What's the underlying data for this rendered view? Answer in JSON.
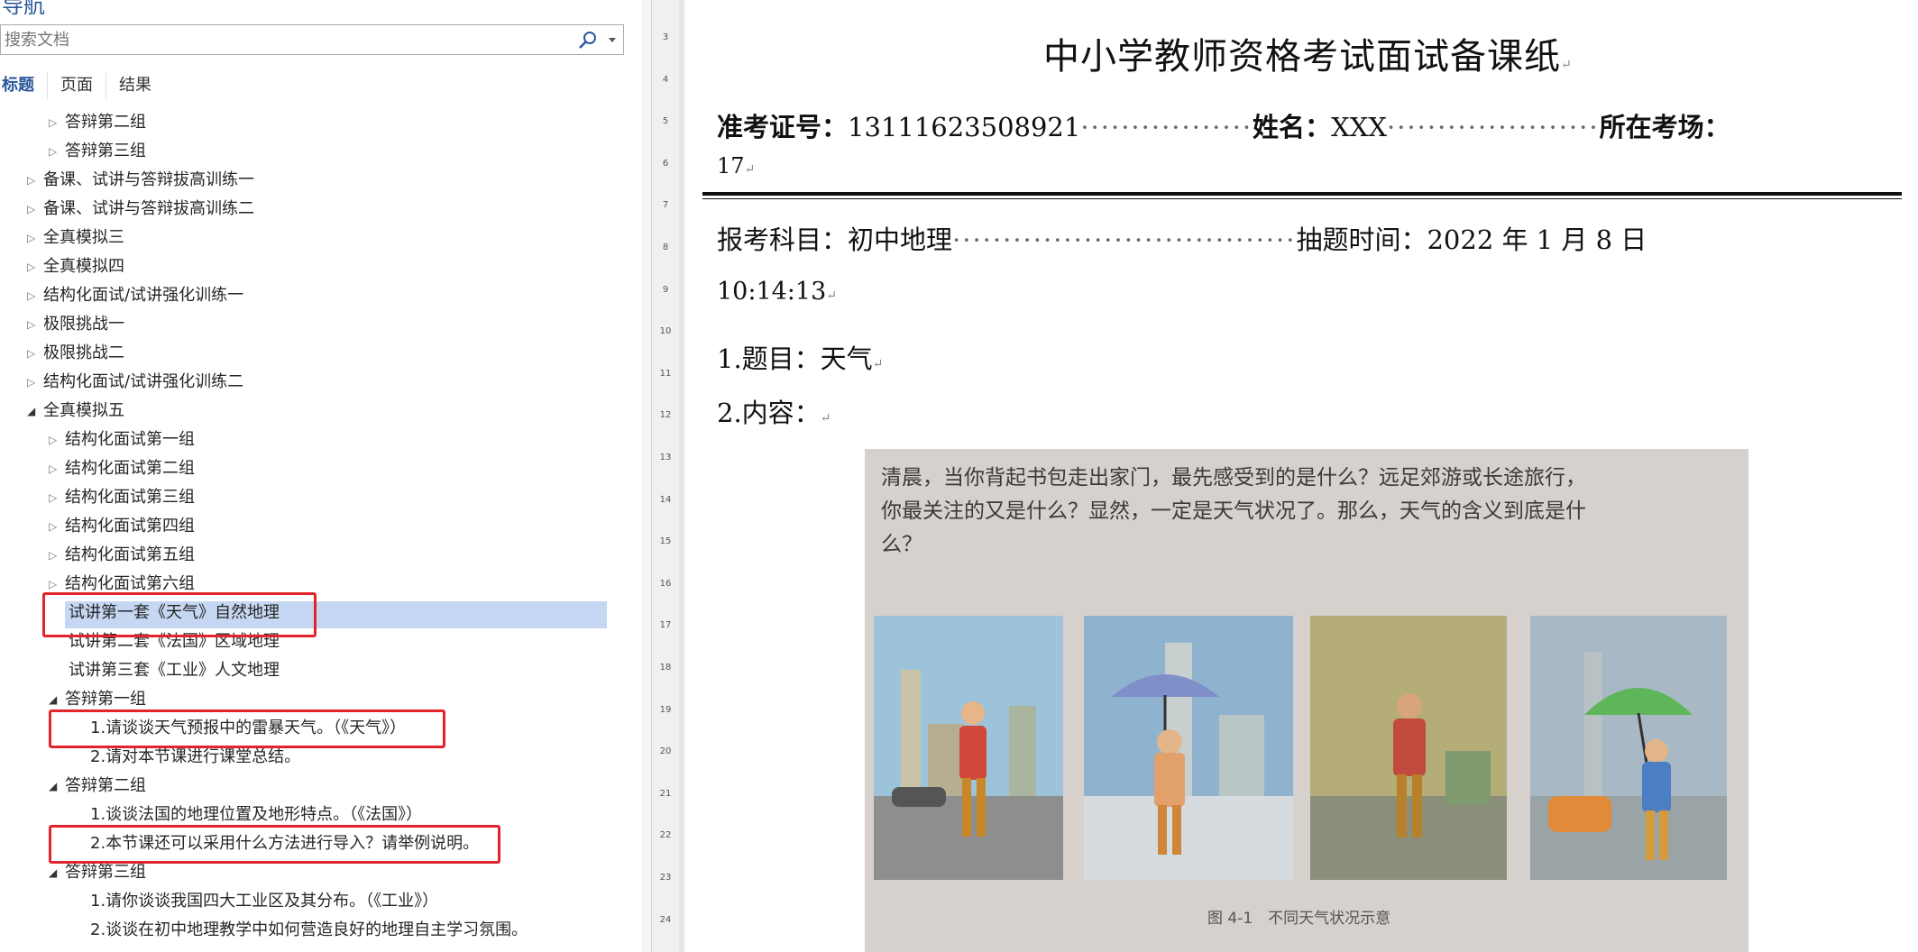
{
  "nav": {
    "title": "导航",
    "search_placeholder": "搜索文档",
    "tabs": [
      "标题",
      "页面",
      "结果"
    ],
    "items": [
      {
        "label": "答辩第二组",
        "level": 2,
        "open": false
      },
      {
        "label": "答辩第三组",
        "level": 2,
        "open": false
      },
      {
        "label": "备课、试讲与答辩拔高训练一",
        "level": 1,
        "open": false
      },
      {
        "label": "备课、试讲与答辩拔高训练二",
        "level": 1,
        "open": false
      },
      {
        "label": "全真模拟三",
        "level": 1,
        "open": false
      },
      {
        "label": "全真模拟四",
        "level": 1,
        "open": false
      },
      {
        "label": "结构化面试/试讲强化训练一",
        "level": 1,
        "open": false
      },
      {
        "label": "极限挑战一",
        "level": 1,
        "open": false
      },
      {
        "label": "极限挑战二",
        "level": 1,
        "open": false
      },
      {
        "label": "结构化面试/试讲强化训练二",
        "level": 1,
        "open": false
      },
      {
        "label": "全真模拟五",
        "level": 1,
        "open": true
      },
      {
        "label": "结构化面试第一组",
        "level": 2,
        "open": false
      },
      {
        "label": "结构化面试第二组",
        "level": 2,
        "open": false
      },
      {
        "label": "结构化面试第三组",
        "level": 2,
        "open": false
      },
      {
        "label": "结构化面试第四组",
        "level": 2,
        "open": false
      },
      {
        "label": "结构化面试第五组",
        "level": 2,
        "open": false
      },
      {
        "label": "结构化面试第六组",
        "level": 2,
        "open": false
      },
      {
        "label": "试讲第一套《天气》自然地理",
        "level": 3,
        "leaf": true,
        "selected": true
      },
      {
        "label": "试讲第二套《法国》区域地理",
        "level": 3,
        "leaf": true
      },
      {
        "label": "试讲第三套《工业》人文地理",
        "level": 3,
        "leaf": true
      },
      {
        "label": "答辩第一组",
        "level": 2,
        "open": true
      },
      {
        "label": "1.请谈谈天气预报中的雷暴天气。（《天气》）",
        "level": 4,
        "leaf": true
      },
      {
        "label": "2.请对本节课进行课堂总结。",
        "level": 4,
        "leaf": true
      },
      {
        "label": "答辩第二组",
        "level": 2,
        "open": true
      },
      {
        "label": "1.谈谈法国的地理位置及地形特点。（《法国》）",
        "level": 4,
        "leaf": true
      },
      {
        "label": "2.本节课还可以采用什么方法进行导入？请举例说明。",
        "level": 4,
        "leaf": true
      },
      {
        "label": "答辩第三组",
        "level": 2,
        "open": true
      },
      {
        "label": "1.请你谈谈我国四大工业区及其分布。（《工业》）",
        "level": 4,
        "leaf": true
      },
      {
        "label": "2.谈谈在初中地理教学中如何营造良好的地理自主学习氛围。",
        "level": 4,
        "leaf": true
      }
    ]
  },
  "ruler": {
    "numbers": [
      "3",
      "4",
      "5",
      "6",
      "7",
      "8",
      "9",
      "10",
      "11",
      "12",
      "13",
      "14",
      "15",
      "16",
      "17",
      "18",
      "19",
      "20",
      "21",
      "22",
      "23",
      "24"
    ]
  },
  "doc": {
    "title": "中小学教师资格考试面试备课纸",
    "exam_no_label": "准考证号：",
    "exam_no": "13111623508921",
    "name_label": "姓名：",
    "name": "XXX",
    "venue_label": "所在考场：",
    "venue": "17",
    "subject_label": "报考科目：",
    "subject": "初中地理",
    "time_label": "抽题时间：",
    "time_date": "2022 年 1 月 8 日",
    "time_clock": "10:14:13",
    "topic": "1.题目：天气",
    "content": "2.内容：",
    "photo_text": "清晨，当你背起书包走出家门，最先感受到的是什么？远足郊游或长途旅行，你最关注的又是什么？显然，一定是天气状况了。那么，天气的含义到底是什么？",
    "photo_caption": "图 4-1　不同天气状况示意"
  },
  "colors": {
    "accent": "#2b579a",
    "selection": "#c5d7f2",
    "red_box": "#e3242b"
  }
}
